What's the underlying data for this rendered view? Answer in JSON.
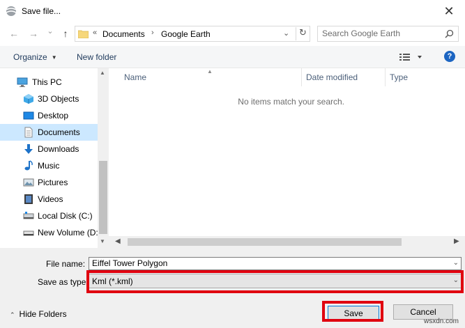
{
  "window": {
    "title": "Save file...",
    "close_glyph": "✕"
  },
  "nav": {
    "back_glyph": "←",
    "forward_glyph": "→",
    "history_glyph": "⌄",
    "up_glyph": "↑"
  },
  "address": {
    "prefix": "«",
    "crumbs": [
      "Documents",
      "Google Earth"
    ],
    "separator": "›",
    "dropdown_glyph": "⌄",
    "refresh_glyph": "↻"
  },
  "search": {
    "placeholder": "Search Google Earth"
  },
  "toolbar": {
    "organize": "Organize",
    "caret": "▼",
    "new_folder": "New folder",
    "help": "?"
  },
  "sidebar": {
    "items": [
      {
        "label": "This PC",
        "icon": "pc-icon",
        "root": true
      },
      {
        "label": "3D Objects",
        "icon": "3d-objects-icon"
      },
      {
        "label": "Desktop",
        "icon": "desktop-icon"
      },
      {
        "label": "Documents",
        "icon": "documents-icon",
        "selected": true
      },
      {
        "label": "Downloads",
        "icon": "downloads-icon"
      },
      {
        "label": "Music",
        "icon": "music-icon"
      },
      {
        "label": "Pictures",
        "icon": "pictures-icon"
      },
      {
        "label": "Videos",
        "icon": "videos-icon"
      },
      {
        "label": "Local Disk (C:)",
        "icon": "drive-icon"
      },
      {
        "label": "New Volume (D:",
        "icon": "drive-icon"
      }
    ]
  },
  "file_list": {
    "columns": [
      "Name",
      "Date modified",
      "Type"
    ],
    "empty_message": "No items match your search."
  },
  "form": {
    "filename_label": "File name:",
    "filename_value": "Eiffel Tower Polygon",
    "type_label": "Save as type:",
    "type_value": "Kml (*.kml)"
  },
  "footer": {
    "hide_folders": "Hide Folders",
    "chevron": "⌃",
    "save": "Save",
    "cancel": "Cancel"
  },
  "watermark": "wsxdn.com",
  "colors": {
    "highlight": "#e0000f",
    "selection": "#cce8ff",
    "accent": "#0078d7"
  }
}
